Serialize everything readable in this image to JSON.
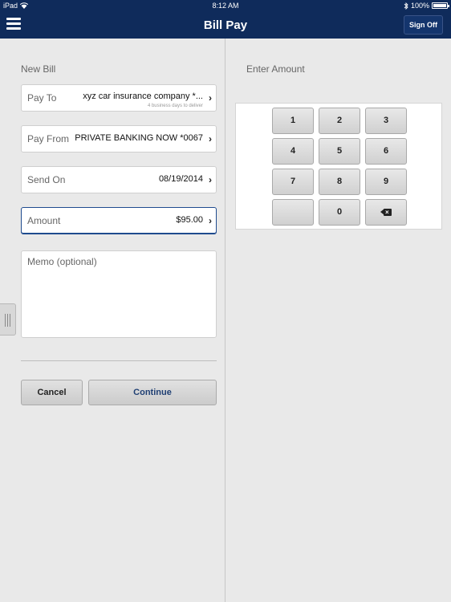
{
  "status_bar": {
    "device": "iPad",
    "time": "8:12 AM",
    "battery": "100%",
    "wifi_icon": "wifi-icon",
    "bluetooth_icon": "bluetooth-icon"
  },
  "nav": {
    "title": "Bill Pay",
    "sign_off_label": "Sign Off",
    "menu_icon": "hamburger-menu-icon",
    "background_color": "#0f2b5b"
  },
  "form": {
    "title": "New Bill",
    "fields": [
      {
        "label": "Pay To",
        "value": "xyz car insurance company *...",
        "sub": "4 business days to deliver"
      },
      {
        "label": "Pay From",
        "value": "PRIVATE BANKING NOW *0067"
      },
      {
        "label": "Send On",
        "value": "08/19/2014"
      },
      {
        "label": "Amount",
        "value": "$95.00"
      }
    ],
    "memo_placeholder": "Memo (optional)",
    "cancel_label": "Cancel",
    "continue_label": "Continue"
  },
  "keypad": {
    "title": "Enter Amount",
    "keys": [
      "1",
      "2",
      "3",
      "4",
      "5",
      "6",
      "7",
      "8",
      "9",
      "",
      "0"
    ],
    "backspace_icon": "backspace-icon"
  },
  "colors": {
    "accent": "#1f4b8e",
    "continue_text": "#1f3f73"
  }
}
